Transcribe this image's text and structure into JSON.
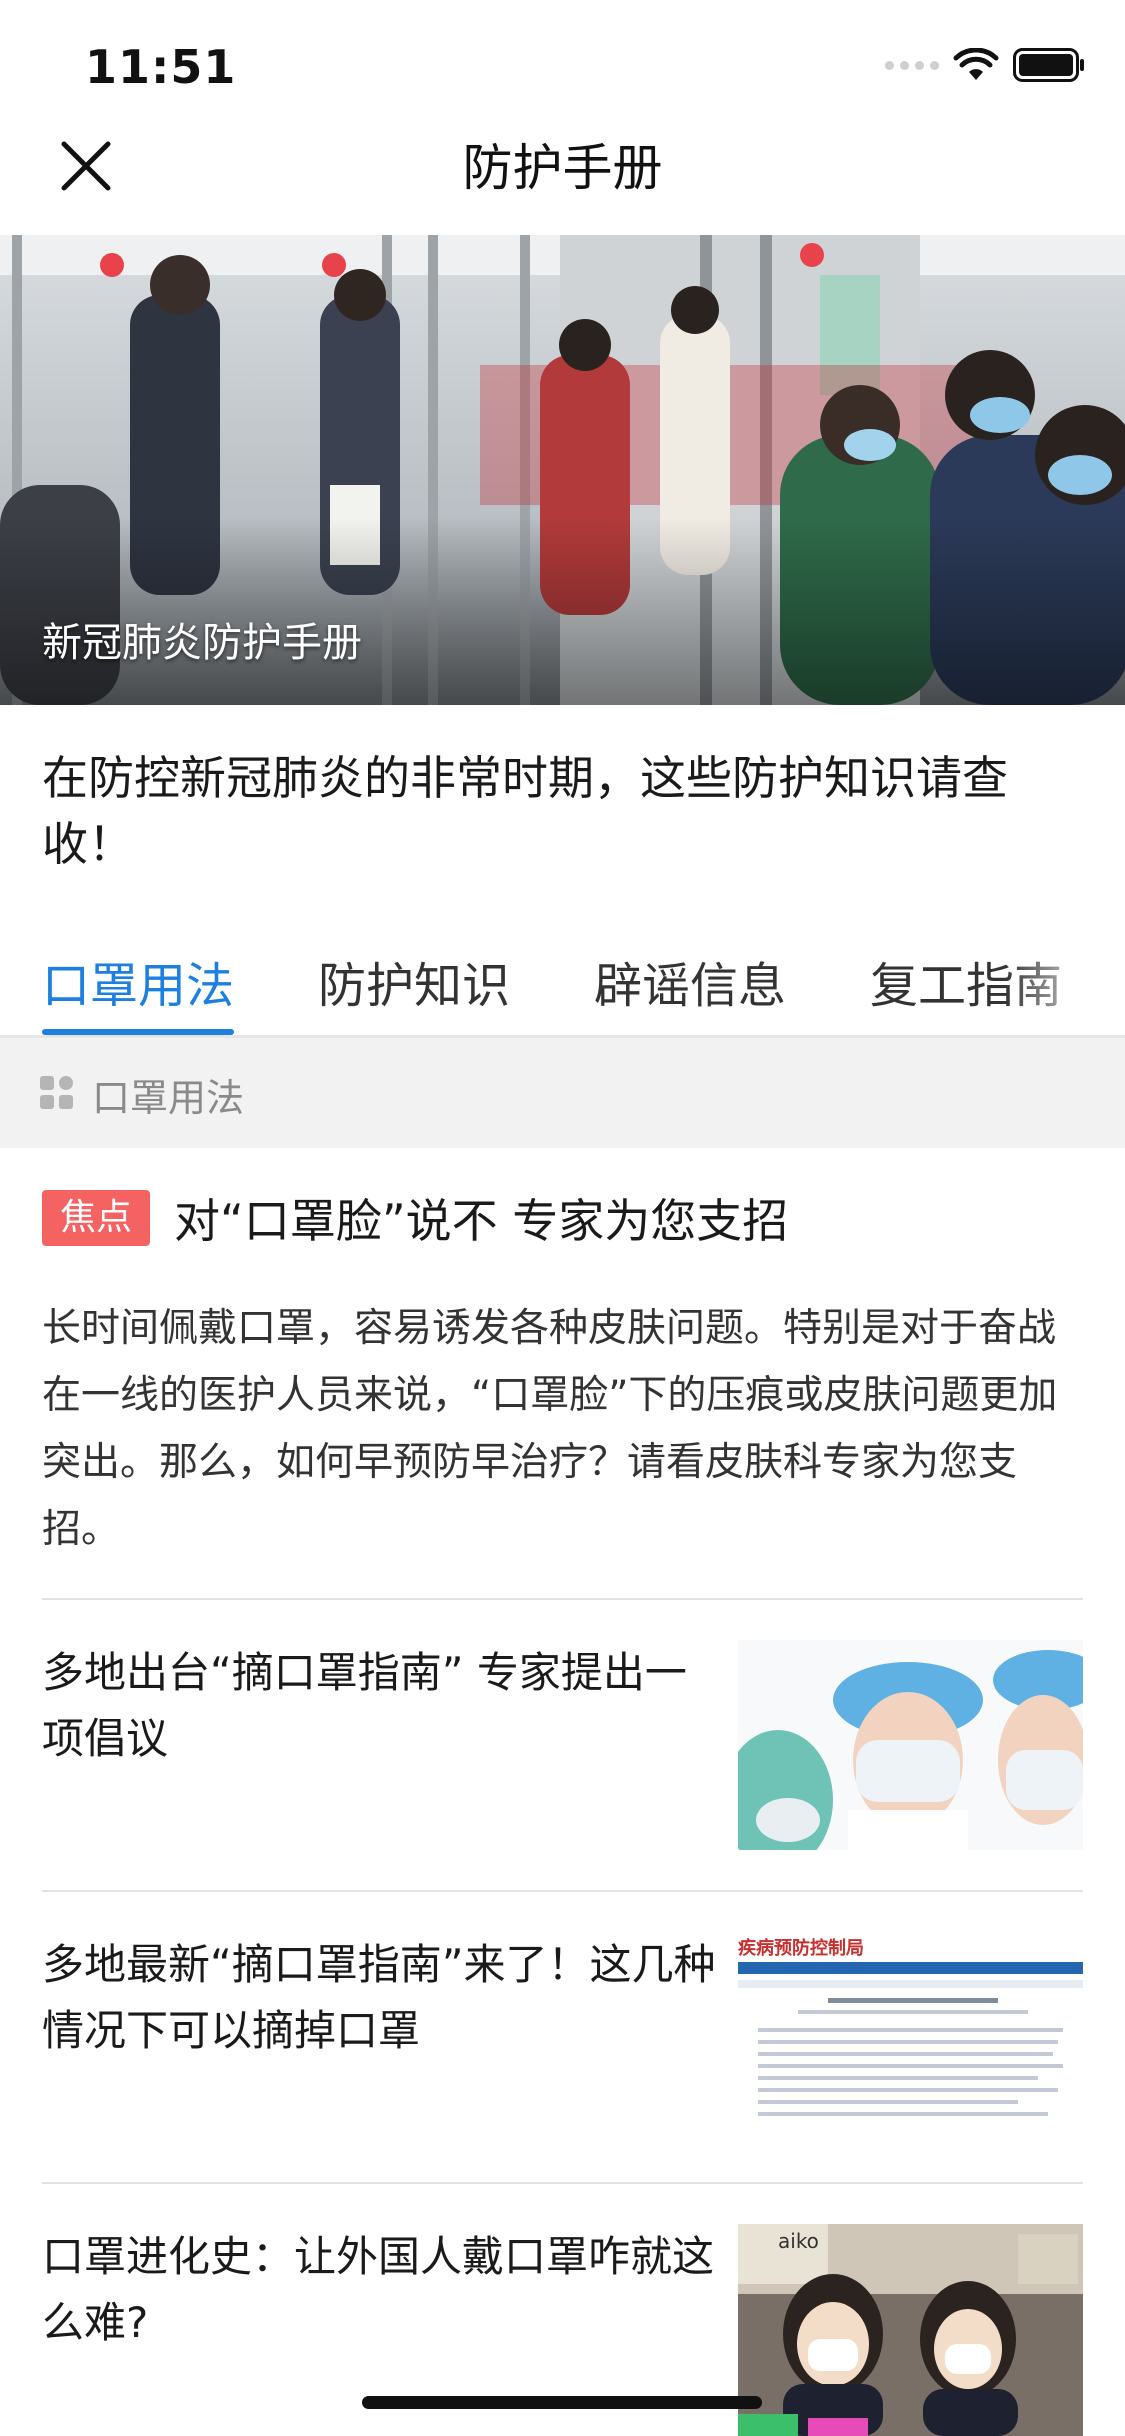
{
  "status_bar": {
    "time": "11:51"
  },
  "nav": {
    "title": "防护手册"
  },
  "hero": {
    "caption": "新冠肺炎防护手册"
  },
  "intro": {
    "text": "在防控新冠肺炎的非常时期，这些防护知识请查收！"
  },
  "tabs": [
    {
      "label": "口罩用法",
      "active": true
    },
    {
      "label": "防护知识",
      "active": false
    },
    {
      "label": "辟谣信息",
      "active": false
    },
    {
      "label": "复工指南",
      "active": false
    }
  ],
  "section": {
    "label": "口罩用法"
  },
  "feature": {
    "badge": "焦点",
    "title": "对“口罩脸”说不 专家为您支招",
    "description": "长时间佩戴口罩，容易诱发各种皮肤问题。特别是对于奋战在一线的医护人员来说，“口罩脸”下的压痕或皮肤问题更加突出。那么，如何早预防早治疗？请看皮肤科专家为您支招。"
  },
  "news": [
    {
      "title": "多地出台“摘口罩指南” 专家提出一项倡议",
      "thumb": "medical-staff-photo"
    },
    {
      "title": "多地最新“摘口罩指南”来了！这几种情况下可以摘掉口罩",
      "thumb": "document-screenshot",
      "thumb_text": "疾病预防控制局"
    },
    {
      "title": "口罩进化史：让外国人戴口罩咋就这么难?",
      "thumb": "street-photo",
      "thumb_text": "aiko"
    }
  ],
  "colors": {
    "accent": "#1d7fe0",
    "badge": "#f46262",
    "section_bg": "#f2f2f2"
  }
}
